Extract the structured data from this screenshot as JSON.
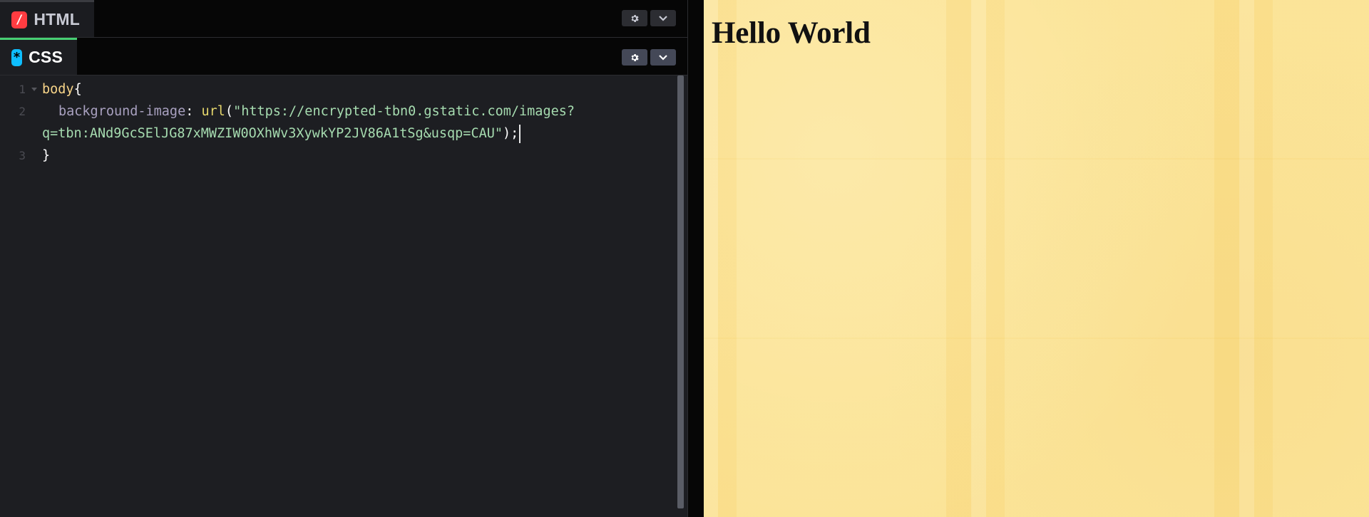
{
  "editor": {
    "html_panel": {
      "label": "HTML",
      "icon": "html-slash-icon"
    },
    "css_panel": {
      "label": "CSS",
      "icon": "css-asterisk-icon"
    },
    "settings_icon": "gear-icon",
    "collapse_icon": "chevron-down-icon",
    "code_lines": [
      {
        "number": "1",
        "selector": "body",
        "brace": "{"
      },
      {
        "number": "2",
        "property": "background-image",
        "colon": ": ",
        "fn": "url",
        "open": "(",
        "string_part1": "\"https://encrypted-tbn0.gstatic.com/images?",
        "string_part2": "q=tbn:ANd9GcSElJG87xMWZIW0OXhWv3XywkYP2JV86A1tSg&usqp=CAU\"",
        "close": ");"
      },
      {
        "number": "3",
        "brace": "}"
      }
    ],
    "colors": {
      "html_icon": "#ff3c41",
      "css_icon": "#0ebeff",
      "background": "#1d1e22"
    }
  },
  "preview": {
    "heading": "Hello World",
    "background_color": "#fbe08d"
  }
}
